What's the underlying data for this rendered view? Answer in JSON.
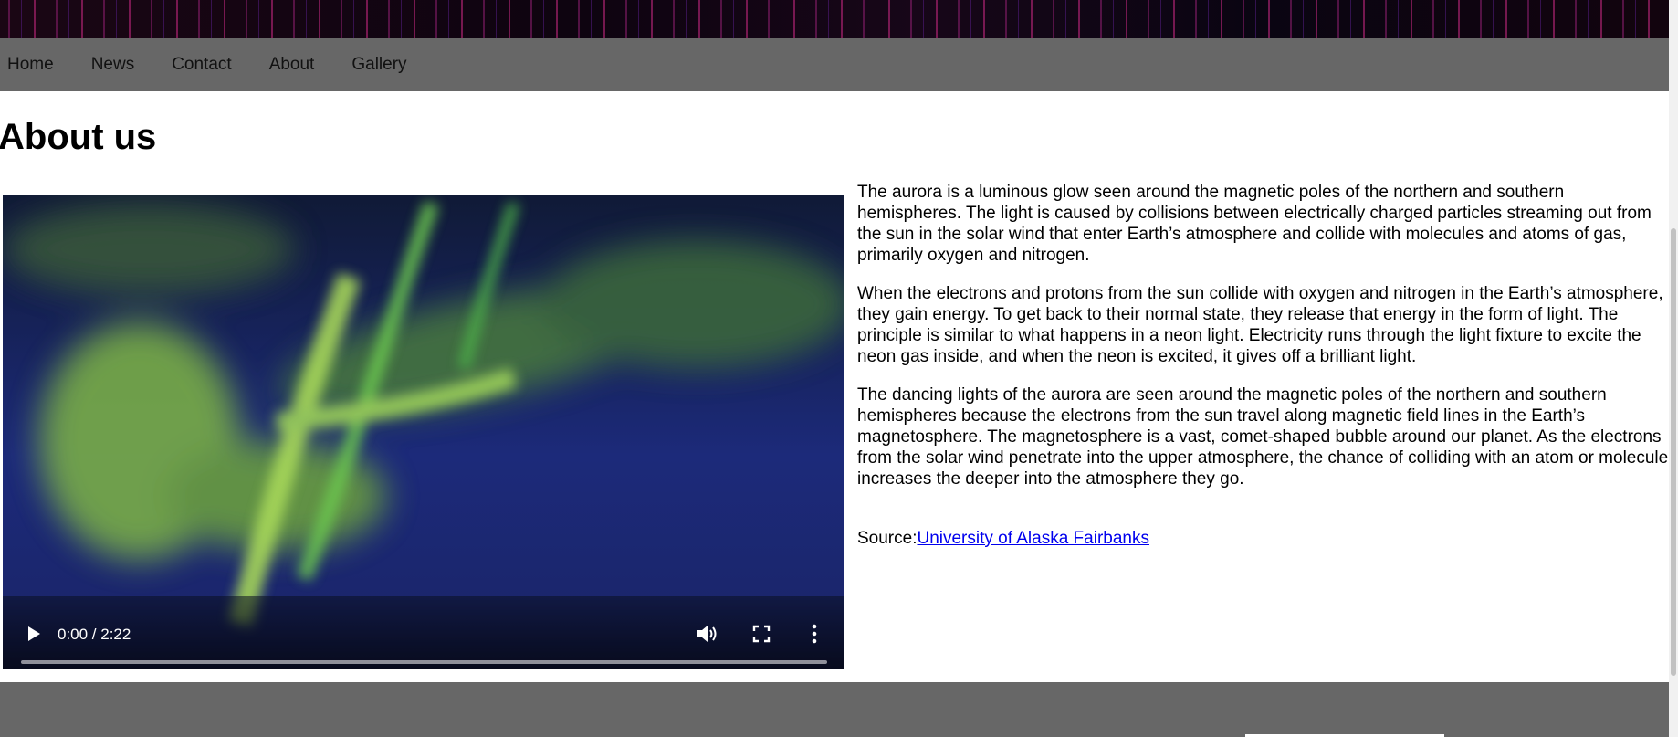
{
  "nav": {
    "items": [
      "Home",
      "News",
      "Contact",
      "About",
      "Gallery"
    ]
  },
  "page": {
    "title": "About us"
  },
  "video": {
    "time_display": "0:00 / 2:22",
    "progress": 0
  },
  "content": {
    "paragraphs": [
      "The aurora is a luminous glow seen around the magnetic poles of the northern and southern hemispheres. The light is caused by collisions between electrically charged particles streaming out from the sun in the solar wind that enter Earth’s atmosphere and collide with molecules and atoms of gas, primarily oxygen and nitrogen.",
      "When the electrons and protons from the sun collide with oxygen and nitrogen in the Earth’s atmosphere, they gain energy. To get back to their normal state, they release that energy in the form of light. The principle is similar to what happens in a neon light. Electricity runs through the light fixture to excite the neon gas inside, and when the neon is excited, it gives off a brilliant light.",
      "The dancing lights of the aurora are seen around the magnetic poles of the northern and southern hemispheres because the electrons from the sun travel along magnetic field lines in the Earth’s magnetosphere. The magnetosphere is a vast, comet-shaped bubble around our planet. As the electrons from the solar wind penetrate into the upper atmosphere, the chance of colliding with an atom or molecule increases the deeper into the atmosphere they go."
    ],
    "source_label": "Source:",
    "source_link": "University of Alaska Fairbanks"
  },
  "colors": {
    "nav_bg": "#676767",
    "link": "#0000ee",
    "aurora_green": "#8fc64a",
    "sky": "#1a2a78"
  }
}
